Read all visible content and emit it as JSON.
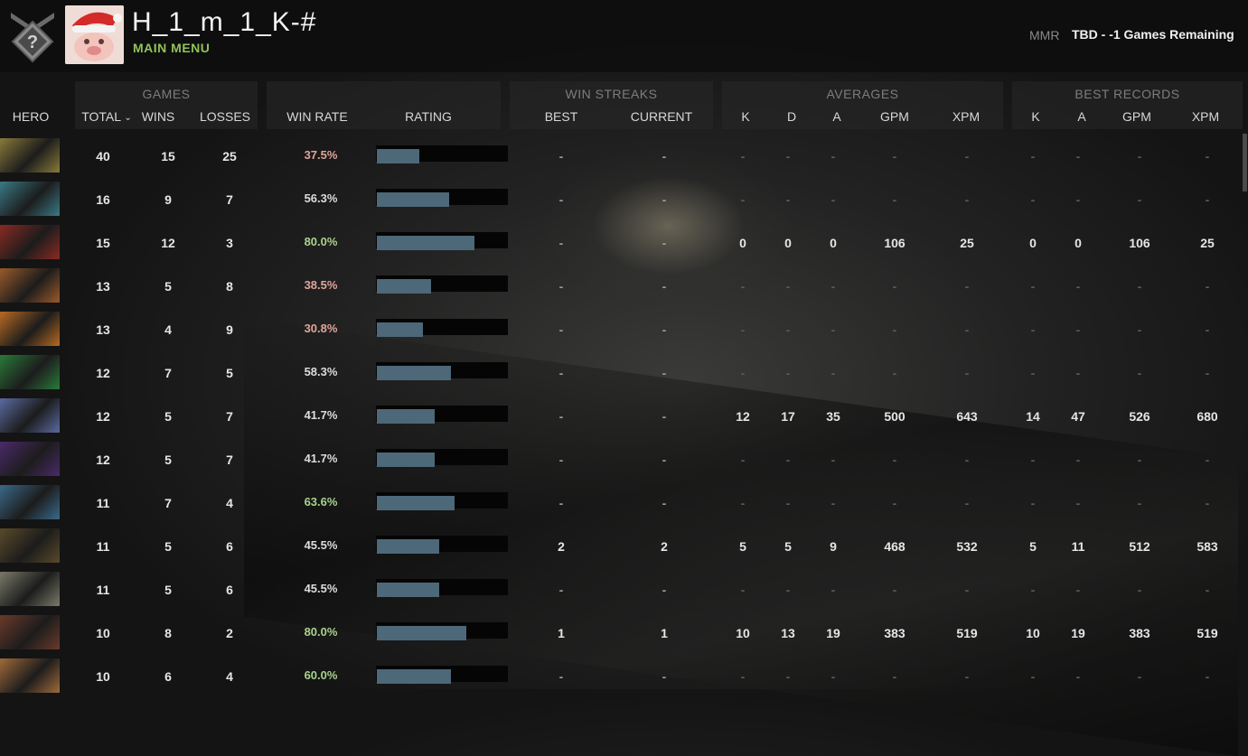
{
  "header": {
    "player_name": "H_1_m_1_K-#",
    "main_menu": "MAIN MENU",
    "mmr_label": "MMR",
    "mmr_value": "TBD - -1 Games Remaining",
    "rank_icon": "unranked-medal-icon",
    "avatar_icon": "santa-hat-avatar"
  },
  "columns": {
    "hero": "HERO",
    "games": {
      "title": "GAMES",
      "total": "TOTAL",
      "wins": "WINS",
      "losses": "LOSSES"
    },
    "win_rate": "WIN RATE",
    "rating": "RATING",
    "win_streaks": {
      "title": "WIN STREAKS",
      "best": "BEST",
      "current": "CURRENT"
    },
    "averages": {
      "title": "AVERAGES",
      "k": "K",
      "d": "D",
      "a": "A",
      "gpm": "GPM",
      "xpm": "XPM"
    },
    "best_records": {
      "title": "BEST RECORDS",
      "k": "K",
      "a": "A",
      "gpm": "GPM",
      "xpm": "XPM"
    },
    "sort_icon": "chevron-down-icon"
  },
  "colors": {
    "win_rate_low": "#e0a49a",
    "win_rate_mid": "#dcdcdc",
    "win_rate_high": "#a9d28c",
    "accent_green": "#8ec25a",
    "rating_bar": "#4d6878"
  },
  "rows": [
    {
      "hero_color": "#8a7a3a",
      "total": "40",
      "wins": "15",
      "losses": "25",
      "win_rate": "37.5%",
      "rating": 0.32,
      "best": "-",
      "current": "-",
      "avg_k": "-",
      "avg_d": "-",
      "avg_a": "-",
      "avg_gpm": "-",
      "avg_xpm": "-",
      "best_k": "-",
      "best_a": "-",
      "best_gpm": "-",
      "best_xpm": "-"
    },
    {
      "hero_color": "#3a7a86",
      "total": "16",
      "wins": "9",
      "losses": "7",
      "win_rate": "56.3%",
      "rating": 0.55,
      "best": "-",
      "current": "-",
      "avg_k": "-",
      "avg_d": "-",
      "avg_a": "-",
      "avg_gpm": "-",
      "avg_xpm": "-",
      "best_k": "-",
      "best_a": "-",
      "best_gpm": "-",
      "best_xpm": "-"
    },
    {
      "hero_color": "#8a2a22",
      "total": "15",
      "wins": "12",
      "losses": "3",
      "win_rate": "80.0%",
      "rating": 0.74,
      "best": "-",
      "current": "-",
      "avg_k": "0",
      "avg_d": "0",
      "avg_a": "0",
      "avg_gpm": "106",
      "avg_xpm": "25",
      "best_k": "0",
      "best_a": "0",
      "best_gpm": "106",
      "best_xpm": "25"
    },
    {
      "hero_color": "#9a5a2a",
      "total": "13",
      "wins": "5",
      "losses": "8",
      "win_rate": "38.5%",
      "rating": 0.41,
      "best": "-",
      "current": "-",
      "avg_k": "-",
      "avg_d": "-",
      "avg_a": "-",
      "avg_gpm": "-",
      "avg_xpm": "-",
      "best_k": "-",
      "best_a": "-",
      "best_gpm": "-",
      "best_xpm": "-"
    },
    {
      "hero_color": "#b86a22",
      "total": "13",
      "wins": "4",
      "losses": "9",
      "win_rate": "30.8%",
      "rating": 0.35,
      "best": "-",
      "current": "-",
      "avg_k": "-",
      "avg_d": "-",
      "avg_a": "-",
      "avg_gpm": "-",
      "avg_xpm": "-",
      "best_k": "-",
      "best_a": "-",
      "best_gpm": "-",
      "best_xpm": "-"
    },
    {
      "hero_color": "#2a7a3a",
      "total": "12",
      "wins": "7",
      "losses": "5",
      "win_rate": "58.3%",
      "rating": 0.56,
      "best": "-",
      "current": "-",
      "avg_k": "-",
      "avg_d": "-",
      "avg_a": "-",
      "avg_gpm": "-",
      "avg_xpm": "-",
      "best_k": "-",
      "best_a": "-",
      "best_gpm": "-",
      "best_xpm": "-"
    },
    {
      "hero_color": "#5a6aa0",
      "total": "12",
      "wins": "5",
      "losses": "7",
      "win_rate": "41.7%",
      "rating": 0.44,
      "best": "-",
      "current": "-",
      "avg_k": "12",
      "avg_d": "17",
      "avg_a": "35",
      "avg_gpm": "500",
      "avg_xpm": "643",
      "best_k": "14",
      "best_a": "47",
      "best_gpm": "526",
      "best_xpm": "680"
    },
    {
      "hero_color": "#4a2a6a",
      "total": "12",
      "wins": "5",
      "losses": "7",
      "win_rate": "41.7%",
      "rating": 0.44,
      "best": "-",
      "current": "-",
      "avg_k": "-",
      "avg_d": "-",
      "avg_a": "-",
      "avg_gpm": "-",
      "avg_xpm": "-",
      "best_k": "-",
      "best_a": "-",
      "best_gpm": "-",
      "best_xpm": "-"
    },
    {
      "hero_color": "#3a6a8a",
      "total": "11",
      "wins": "7",
      "losses": "4",
      "win_rate": "63.6%",
      "rating": 0.59,
      "best": "-",
      "current": "-",
      "avg_k": "-",
      "avg_d": "-",
      "avg_a": "-",
      "avg_gpm": "-",
      "avg_xpm": "-",
      "best_k": "-",
      "best_a": "-",
      "best_gpm": "-",
      "best_xpm": "-"
    },
    {
      "hero_color": "#5a4a2a",
      "total": "11",
      "wins": "5",
      "losses": "6",
      "win_rate": "45.5%",
      "rating": 0.47,
      "best": "2",
      "current": "2",
      "avg_k": "5",
      "avg_d": "5",
      "avg_a": "9",
      "avg_gpm": "468",
      "avg_xpm": "532",
      "best_k": "5",
      "best_a": "11",
      "best_gpm": "512",
      "best_xpm": "583"
    },
    {
      "hero_color": "#7a7a6a",
      "total": "11",
      "wins": "5",
      "losses": "6",
      "win_rate": "45.5%",
      "rating": 0.47,
      "best": "-",
      "current": "-",
      "avg_k": "-",
      "avg_d": "-",
      "avg_a": "-",
      "avg_gpm": "-",
      "avg_xpm": "-",
      "best_k": "-",
      "best_a": "-",
      "best_gpm": "-",
      "best_xpm": "-"
    },
    {
      "hero_color": "#6a3a2a",
      "total": "10",
      "wins": "8",
      "losses": "2",
      "win_rate": "80.0%",
      "rating": 0.68,
      "best": "1",
      "current": "1",
      "avg_k": "10",
      "avg_d": "13",
      "avg_a": "19",
      "avg_gpm": "383",
      "avg_xpm": "519",
      "best_k": "10",
      "best_a": "19",
      "best_gpm": "383",
      "best_xpm": "519"
    },
    {
      "hero_color": "#a06a3a",
      "total": "10",
      "wins": "6",
      "losses": "4",
      "win_rate": "60.0%",
      "rating": 0.56,
      "best": "-",
      "current": "-",
      "avg_k": "-",
      "avg_d": "-",
      "avg_a": "-",
      "avg_gpm": "-",
      "avg_xpm": "-",
      "best_k": "-",
      "best_a": "-",
      "best_gpm": "-",
      "best_xpm": "-"
    }
  ]
}
